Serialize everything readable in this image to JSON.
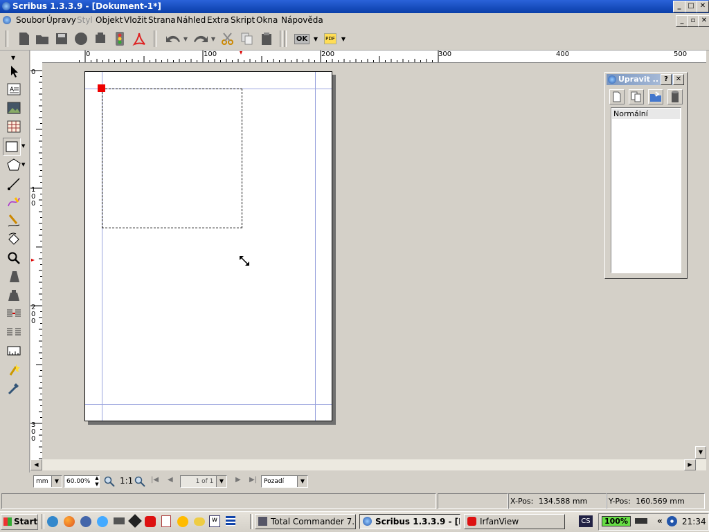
{
  "window": {
    "title": "Scribus 1.3.3.9 - [Dokument-1*]",
    "controls": {
      "minimize": "_",
      "maximize": "□",
      "close": "✕"
    }
  },
  "menu": [
    "Soubor",
    "Úpravy",
    "Styl",
    "Objekt",
    "Vložit",
    "Strana",
    "Náhled",
    "Extra",
    "Skript",
    "Okna",
    "Nápověda"
  ],
  "toolbar": {
    "ok_label": "OK",
    "pdf_label": "PDF"
  },
  "ruler": {
    "h_labels": [
      "0",
      "100",
      "200",
      "300",
      "400",
      "500"
    ],
    "v_labels": [
      "0",
      "100",
      "200",
      "300"
    ]
  },
  "panel": {
    "title": "Upravit ...",
    "help": "?",
    "close": "✕",
    "list_items": [
      "Normální"
    ]
  },
  "zoombar": {
    "unit": "mm",
    "zoom": "60.00%",
    "ratio": "1:1",
    "page": "1 of 1",
    "layer": "Pozadí"
  },
  "status": {
    "xpos_label": "X-Pos:",
    "xpos_value": "134.588 mm",
    "ypos_label": "Y-Pos:",
    "ypos_value": "160.569 mm"
  },
  "taskbar": {
    "start": "Start",
    "tasks": [
      "Total Commander 7.0 ...",
      "Scribus 1.3.3.9 - [D...",
      "IrfanView"
    ],
    "cs": "CS",
    "battery": "100%",
    "tray_chevron": "«",
    "clock": "21:34"
  }
}
